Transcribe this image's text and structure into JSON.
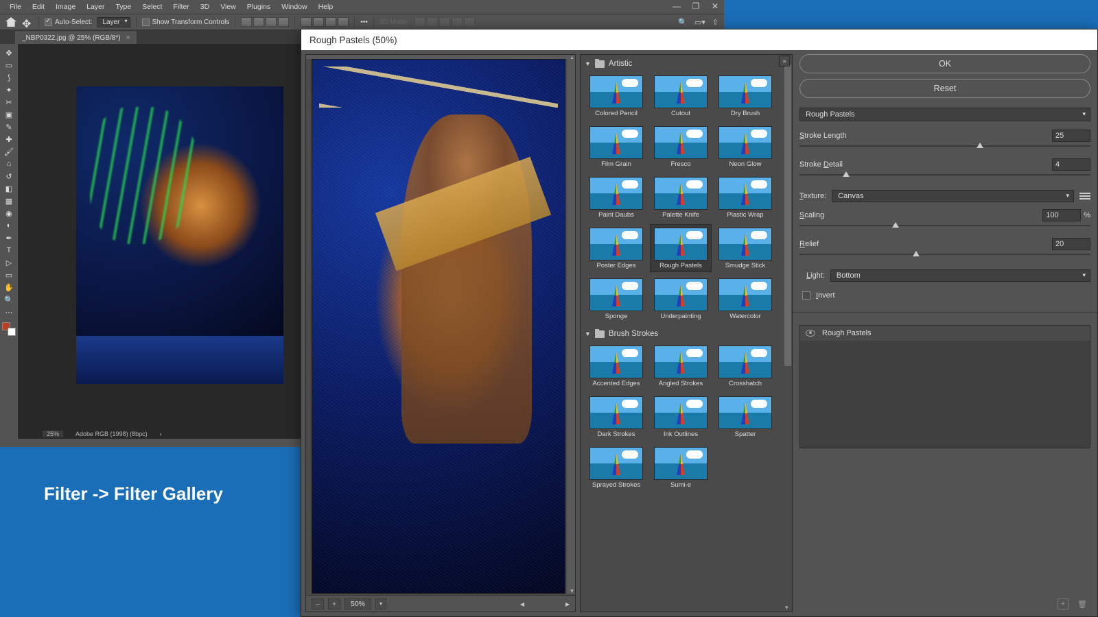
{
  "menu": {
    "items": [
      "File",
      "Edit",
      "Image",
      "Layer",
      "Type",
      "Select",
      "Filter",
      "3D",
      "View",
      "Plugins",
      "Window",
      "Help"
    ]
  },
  "opt": {
    "auto_select": "Auto-Select:",
    "layer": "Layer",
    "transform": "Show Transform Controls",
    "mode": "3D Mode:"
  },
  "tab": {
    "name": "_NBP0322.jpg @ 25% (RGB/8*)"
  },
  "status": {
    "zoom": "25%",
    "profile": "Adobe RGB (1998) (8bpc)"
  },
  "dialog": {
    "title": "Rough Pastels (50%)",
    "ok": "OK",
    "reset": "Reset",
    "filter_name": "Rough Pastels",
    "stroke_length_lbl": "Stroke Length",
    "stroke_length": "25",
    "stroke_detail_lbl": "Stroke Detail",
    "stroke_detail": "4",
    "texture_lbl": "Texture:",
    "texture": "Canvas",
    "scaling_lbl": "Scaling",
    "scaling": "100",
    "relief_lbl": "Relief",
    "relief": "20",
    "light_lbl": "Light:",
    "light": "Bottom",
    "invert_lbl": "Invert",
    "preview_zoom": "50%",
    "layer": "Rough Pastels"
  },
  "cats": {
    "artistic": {
      "name": "Artistic",
      "items": [
        "Colored Pencil",
        "Cutout",
        "Dry Brush",
        "Film Grain",
        "Fresco",
        "Neon Glow",
        "Paint Daubs",
        "Palette Knife",
        "Plastic Wrap",
        "Poster Edges",
        "Rough Pastels",
        "Smudge Stick",
        "Sponge",
        "Underpainting",
        "Watercolor"
      ]
    },
    "brush": {
      "name": "Brush Strokes",
      "items": [
        "Accented Edges",
        "Angled Strokes",
        "Crosshatch",
        "Dark Strokes",
        "Ink Outlines",
        "Spatter",
        "Sprayed Strokes",
        "Sumi-e"
      ]
    }
  },
  "caption": "Filter -> Filter Gallery"
}
